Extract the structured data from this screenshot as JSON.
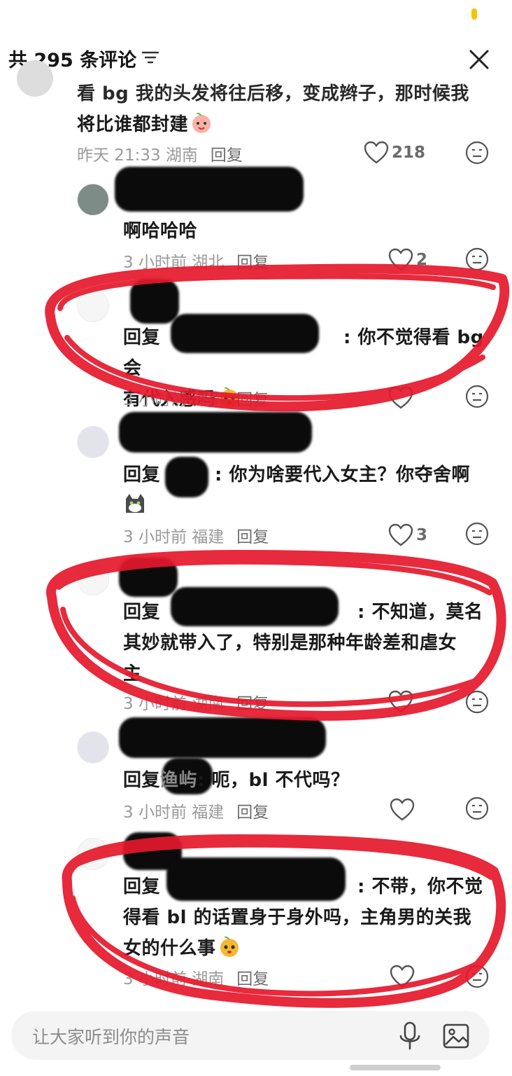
{
  "header": {
    "title": "共 295 条评论"
  },
  "comments": [
    {
      "text_lines": [
        "看 bg 我的头发将往后移，变成辫子，那时候我",
        "将比谁都封建"
      ],
      "time": "昨天 21:33",
      "location": "湖南",
      "reply": "回复",
      "likes": "218"
    },
    {
      "text_lines": [
        "啊哈哈哈"
      ],
      "time": "3 小时前",
      "location": "湖北",
      "reply": "回复",
      "likes": "2"
    },
    {
      "prefix": "回复",
      "text_lines": [
        ": 你不觉得看 bg 会",
        "有代入感吗"
      ],
      "time": "3 小时前",
      "location": "湖南",
      "reply": "回复",
      "likes": ""
    },
    {
      "prefix": "回复",
      "text_lines": [
        ": 你为啥要代入女主？你夺舍啊"
      ],
      "time": "3 小时前",
      "location": "福建",
      "reply": "回复",
      "likes": "3"
    },
    {
      "prefix": "回复",
      "text_lines": [
        ": 不知道，莫名",
        "其妙就带入了，特别是那种年龄差和虐女",
        "主"
      ],
      "time": "3 小时前",
      "location": "湖南",
      "reply": "回复",
      "likes": ""
    },
    {
      "prefix": "回复",
      "text_lines": [
        ": 呃，bl 不代吗？"
      ],
      "time": "3 小时前",
      "location": "福建",
      "reply": "回复",
      "likes": ""
    },
    {
      "prefix": "回复",
      "text_lines": [
        ": 不带，你不觉",
        "得看 bl 的话置身于身外吗，主角男的关我",
        "女的什么事"
      ],
      "time": "3 小时前",
      "location": "湖南",
      "reply": "回复",
      "likes": ""
    }
  ],
  "partial_name": "渔屿",
  "input": {
    "placeholder": "让大家听到你的声音"
  },
  "icons": {
    "filter": "filter-icon",
    "close": "close-icon",
    "like": "heart-icon",
    "dislike": "meh-face-icon",
    "mic": "microphone-icon",
    "image": "image-icon",
    "emoji_peach": "peach-face-emoji",
    "emoji_cat": "cat-emoji"
  },
  "colors": {
    "annotation": "#e5182c",
    "mask": "#0b0b0b"
  }
}
